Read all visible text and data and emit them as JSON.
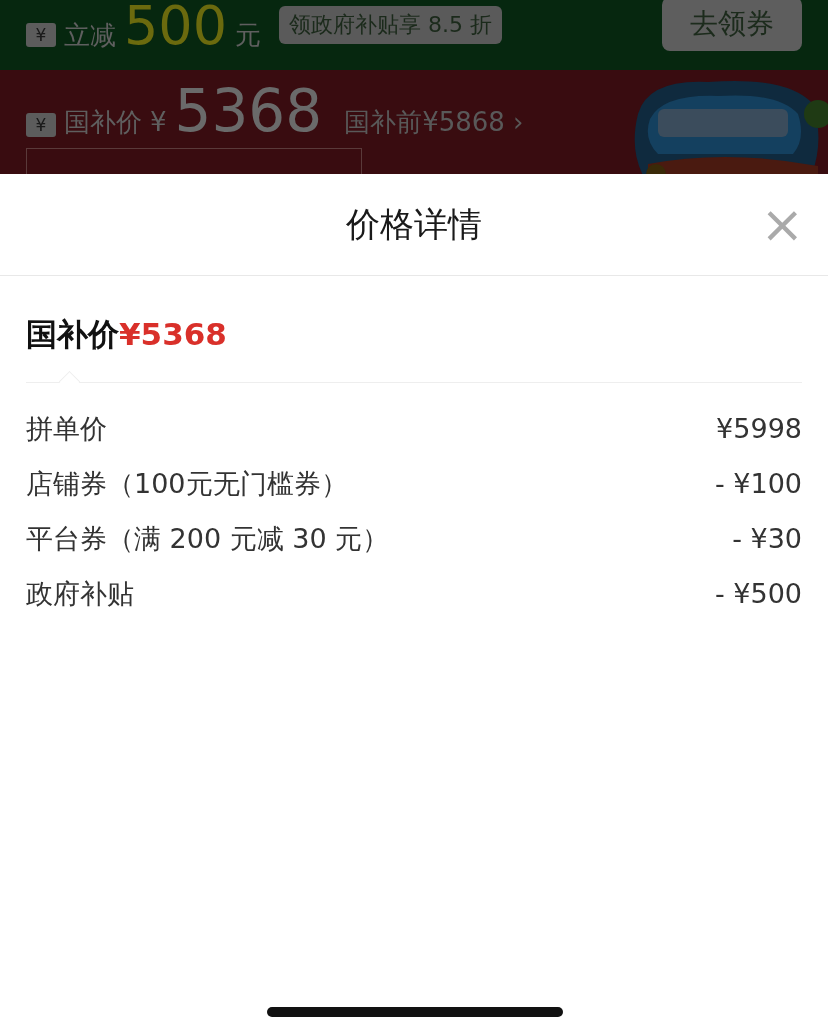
{
  "background": {
    "promo_bar": {
      "icon": "¥",
      "label": "立减",
      "amount": "500",
      "unit": "元",
      "tip": "领政府补贴享 8.5 折",
      "button": "去领券"
    },
    "price_bar": {
      "icon": "¥",
      "label": "国补价",
      "currency": "¥",
      "price": "5368",
      "original": "国补前¥5868",
      "chevron": "›"
    }
  },
  "sheet": {
    "title": "价格详情",
    "close": "×",
    "summary": {
      "label": "国补价",
      "price": "¥5368"
    },
    "rows": [
      {
        "label": "拼单价",
        "value": "¥5998"
      },
      {
        "label": "店铺券（100元无门槛券）",
        "value": "- ¥100"
      },
      {
        "label": "平台券（满 200 元减 30 元）",
        "value": "- ¥30"
      },
      {
        "label": "政府补贴",
        "value": "- ¥500"
      }
    ]
  }
}
